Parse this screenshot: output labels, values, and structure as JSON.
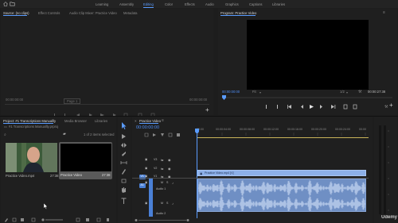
{
  "workspaces": {
    "items": [
      "Learning",
      "Assembly",
      "Editing",
      "Color",
      "Effects",
      "Audio",
      "Graphics",
      "Captions",
      "Libraries"
    ],
    "active": "Editing"
  },
  "source_panel": {
    "tabs": [
      "Source: (no clips)",
      "Effect Controls",
      "Audio Clip Mixer: Practice Video",
      "Metadata"
    ],
    "timecode": "00:00:00:00",
    "page_label": "Page 1",
    "timecode_right": "00:00:00:00"
  },
  "program_panel": {
    "tab": "Program: Practice Video",
    "timecode": "00:00:00:00",
    "fit": "Fit",
    "ratio": "1/2",
    "duration": "00:00:27:38"
  },
  "project_panel": {
    "tabs": [
      "Project: #1 Transcriptions Manuallly",
      "Media Browser",
      "Libraries"
    ],
    "path": "#1 Transcriptions Manuallly.prproj",
    "selection": "1 of 2 items selected",
    "items": [
      {
        "name": "Practice Video.mp4",
        "duration": "27:38"
      },
      {
        "name": "Practice Video",
        "duration": "27:38"
      }
    ]
  },
  "timeline_panel": {
    "tab": "Practice Video",
    "timecode": "00:00:00:00",
    "ruler": [
      "00:00",
      "00:00:04:00",
      "00:00:08:00",
      "00:00:12:00",
      "00:00:16:00",
      "00:00:20:00",
      "00:00:24:00",
      "00:00"
    ],
    "video_tracks": [
      "V3",
      "V2",
      "V1"
    ],
    "audio_tracks": [
      {
        "id": "A1",
        "name": "Audio 1"
      },
      {
        "id": "A2",
        "name": "Audio 2"
      }
    ],
    "clip_label": "Practice Video.mp4 [V]",
    "track_source_labels": [
      "V1",
      "A1"
    ]
  },
  "watermark": "Udemy",
  "colors": {
    "accent": "#5a9cff",
    "video_clip": "#8db0e8",
    "audio_clip": "#6f8fc4",
    "waveform": "#c8d8f3",
    "playhead": "#5a9cff"
  }
}
